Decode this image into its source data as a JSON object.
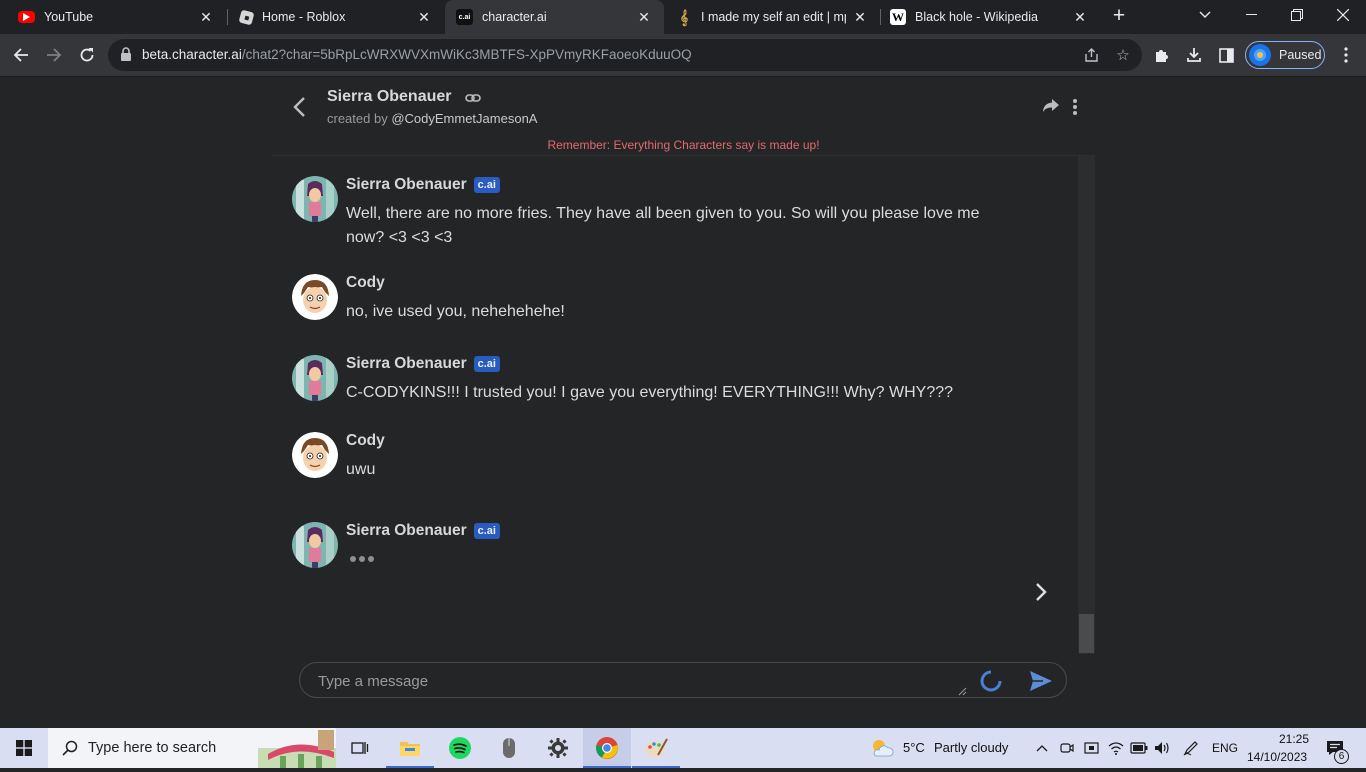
{
  "browser": {
    "tabs": [
      {
        "title": "YouTube"
      },
      {
        "title": "Home - Roblox"
      },
      {
        "title": "character.ai"
      },
      {
        "title": "I made my self an edit | mpp"
      },
      {
        "title": "Black hole - Wikipedia"
      }
    ],
    "url_host": "beta.character.ai",
    "url_path": "/chat2?char=5bRpLcWRXWVXmWiKc3MBTFS-XpPVmyRKFaoeoKduuOQ",
    "profile_label": "Paused"
  },
  "chat": {
    "character_name": "Sierra Obenauer",
    "created_by_prefix": "created by",
    "created_by_user": "@CodyEmmetJamesonA",
    "warning": "Remember: Everything Characters say is made up!",
    "badge": "c.ai",
    "messages": [
      {
        "author": "Sierra Obenauer",
        "text": "Well, there are no more fries. They have all been given to you. So will you please love me now? <3 <3 <3"
      },
      {
        "author": "Cody",
        "text": "no, ive used you, nehehehehe!"
      },
      {
        "author": "Sierra Obenauer",
        "text": "C-CODYKINS!!! I trusted you! I gave you everything! EVERYTHING!!! Why? WHY???"
      },
      {
        "author": "Cody",
        "text": "uwu"
      },
      {
        "author": "Sierra Obenauer",
        "text": ""
      }
    ],
    "input_placeholder": "Type a message"
  },
  "taskbar": {
    "search_placeholder": "Type here to search",
    "weather_temp": "5°C",
    "weather_desc": "Partly cloudy",
    "language": "ENG",
    "time": "21:25",
    "date": "14/10/2023",
    "notification_count": "6"
  },
  "colors": {
    "page_bg": "#242526",
    "warning": "#e46a6a",
    "badge": "#2a5bbf",
    "tab_bar": "#202124",
    "toolbar": "#35363a",
    "taskbar": "#d9def3"
  }
}
